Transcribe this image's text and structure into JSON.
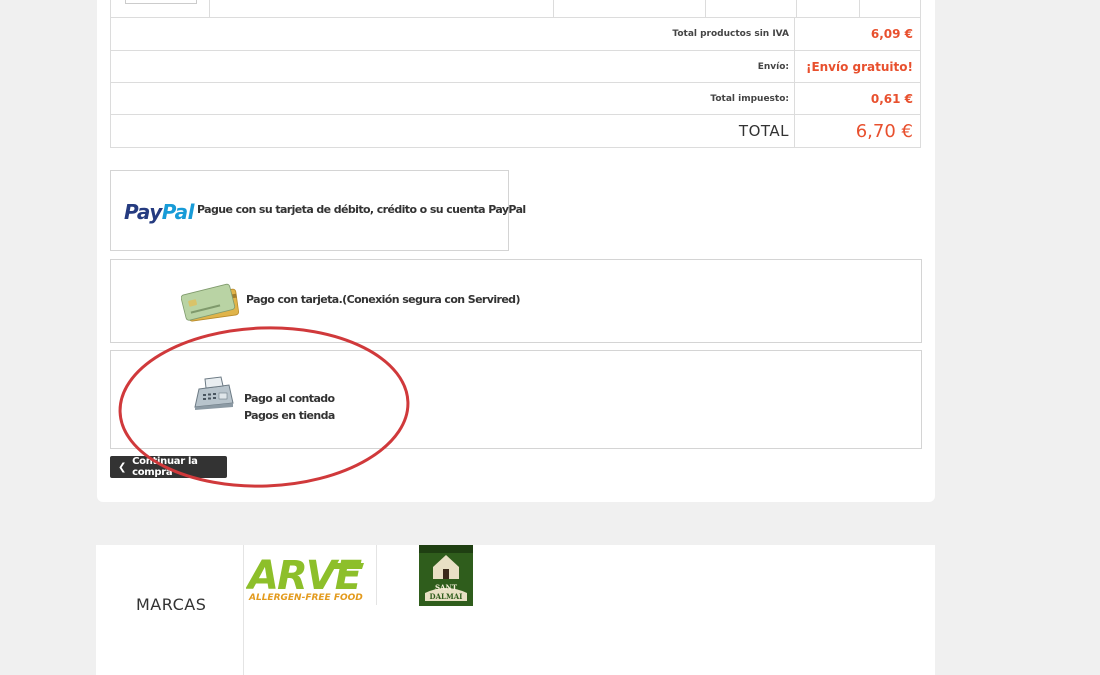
{
  "summary": {
    "rows": [
      {
        "label": "Total productos sin IVA",
        "value": "6,09 €"
      },
      {
        "label": "Envío:",
        "value": "¡Envío gratuito!"
      },
      {
        "label": "Total impuesto:",
        "value": "0,61 €"
      },
      {
        "label": "TOTAL",
        "value": "6,70 €"
      }
    ]
  },
  "payment": {
    "paypal": {
      "logo_p1": "Pay",
      "logo_p2": "Pal",
      "text": "Pague con su tarjeta de débito, crédito o su cuenta PayPal"
    },
    "card": {
      "text": "Pago con tarjeta.(Conexión segura con Servired)"
    },
    "cash": {
      "line1": "Pago al contado",
      "line2": "Pagos en tienda"
    }
  },
  "continue_button": {
    "label": "Continuar la compra"
  },
  "annotation": {
    "color": "#d0393b"
  },
  "brands": {
    "title": "MARCAS",
    "arve": {
      "text": "ARVE",
      "tagline": "ALLERGEN-FREE FOOD"
    },
    "sant_dalmai": {
      "line1": "SANT",
      "line2": "DALMAI"
    }
  },
  "colors": {
    "accent": "#e8502e",
    "paypal_dark": "#253b80",
    "paypal_light": "#179bd7"
  }
}
